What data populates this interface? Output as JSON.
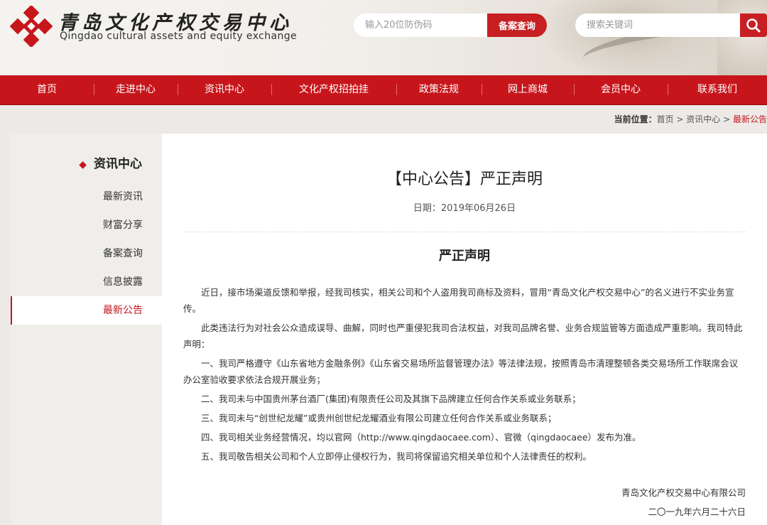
{
  "header": {
    "logo_cn": "青岛文化产权交易中心",
    "logo_en": "Qingdao cultural assets and equity exchange",
    "anti_placeholder": "输入20位防伪码",
    "anti_button": "备案查询",
    "search_placeholder": "搜索关键词"
  },
  "nav": {
    "items": [
      "首页",
      "走进中心",
      "资讯中心",
      "文化产权招拍挂",
      "政策法规",
      "网上商城",
      "会员中心",
      "联系我们"
    ]
  },
  "breadcrumb": {
    "label": "当前位置：",
    "home": "首页",
    "sep": " > ",
    "section": "资讯中心",
    "current": "最新公告"
  },
  "sidebar": {
    "title": "资讯中心",
    "items": [
      "最新资讯",
      "财富分享",
      "备案查询",
      "信息披露",
      "最新公告"
    ]
  },
  "article": {
    "title": "【中心公告】严正声明",
    "date": "日期：2019年06月26日",
    "heading": "严正声明",
    "paragraphs": [
      "近日，接市场渠道反馈和举报，经我司核实，相关公司和个人盗用我司商标及资料，冒用“青岛文化产权交易中心”的名义进行不实业务宣传。",
      "此类违法行为对社会公众造成误导、曲解，同时也严重侵犯我司合法权益，对我司品牌名誉、业务合规监管等方面造成严重影响。我司特此声明：",
      "一、我司严格遵守《山东省地方金融条例》《山东省交易场所监督管理办法》等法律法规，按照青岛市清理整顿各类交易场所工作联席会议办公室验收要求依法合规开展业务；",
      "二、我司未与中国贵州茅台酒厂(集团)有限责任公司及其旗下品牌建立任何合作关系或业务联系；",
      "三、我司未与“创世纪龙耀”或贵州创世纪龙耀酒业有限公司建立任何合作关系或业务联系；",
      "四、我司相关业务经营情况，均以官网（http://www.qingdaocaee.com）、官微（qingdaocaee）发布为准。",
      "五、我司敬告相关公司和个人立即停止侵权行为，我司将保留追究相关单位和个人法律责任的权利。"
    ],
    "sign_company": "青岛文化产权交易中心有限公司",
    "sign_date": "二〇一九年六月二十六日"
  },
  "colors": {
    "brand_red": "#c6161c",
    "button_red": "#c81f22"
  }
}
